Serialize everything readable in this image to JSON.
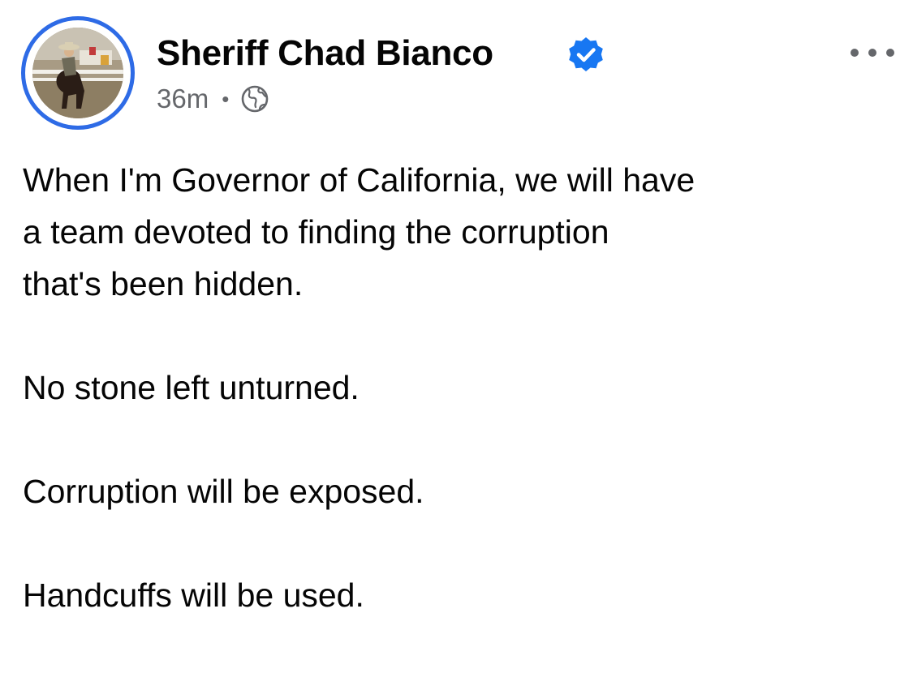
{
  "post": {
    "author": {
      "name": "Sheriff Chad Bianco",
      "verified_icon": "verified-badge-icon",
      "avatar_ring_color": "#2e6be6"
    },
    "timestamp": "36m",
    "separator": "•",
    "audience_icon": "globe-icon",
    "more_icon": "more-options-icon",
    "paragraphs": [
      "When I'm Governor of California, we will have\na team devoted to finding the corruption\nthat's been hidden.",
      "No stone left unturned.",
      "Corruption will be exposed.",
      "Handcuffs will be used."
    ]
  },
  "colors": {
    "verified_badge": "#1877f2",
    "meta_text": "#65676b",
    "body_text": "#050505"
  }
}
